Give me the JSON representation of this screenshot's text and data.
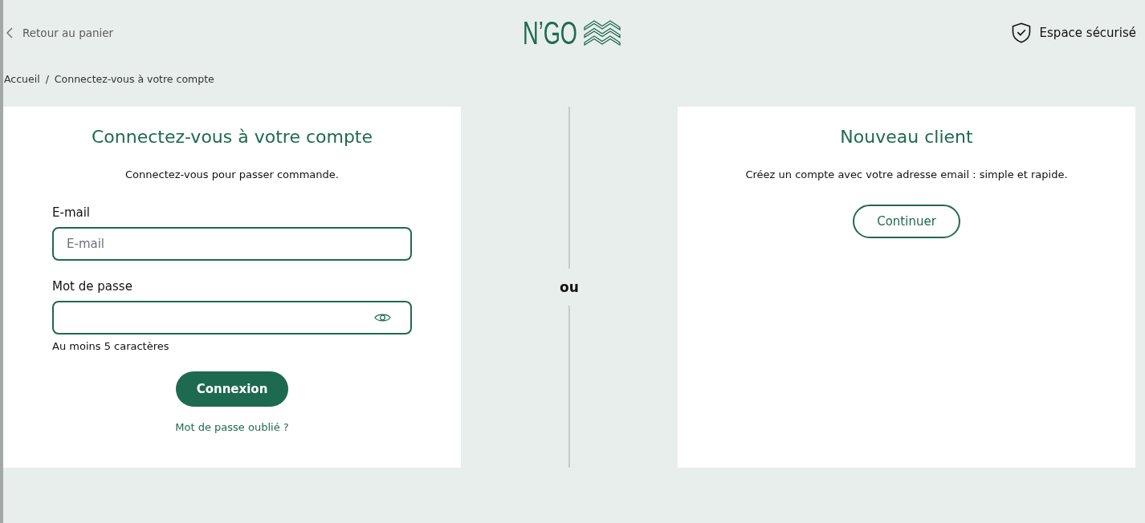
{
  "header": {
    "back_link": "Retour au panier",
    "logo": "N’GO",
    "secure_label": "Espace sécurisé"
  },
  "breadcrumb": {
    "items": [
      "Accueil",
      "Connectez-vous à votre compte"
    ],
    "separator": "/"
  },
  "login": {
    "title": "Connectez-vous à votre compte",
    "subtitle": "Connectez-vous pour passer commande.",
    "fields": [
      {
        "kind": "email",
        "label": "E-mail",
        "placeholder": "E-mail"
      },
      {
        "kind": "password",
        "label": "Mot de passe",
        "hint": "Au moins 5 caractères"
      }
    ],
    "submit": "Connexion",
    "forgot_link": "Mot de passe oublié ?"
  },
  "divider": {
    "label": "ou"
  },
  "signup": {
    "title": "Nouveau client",
    "subtitle": "Créez un compte avec votre adresse email : simple et rapide.",
    "button": "Continuer"
  }
}
